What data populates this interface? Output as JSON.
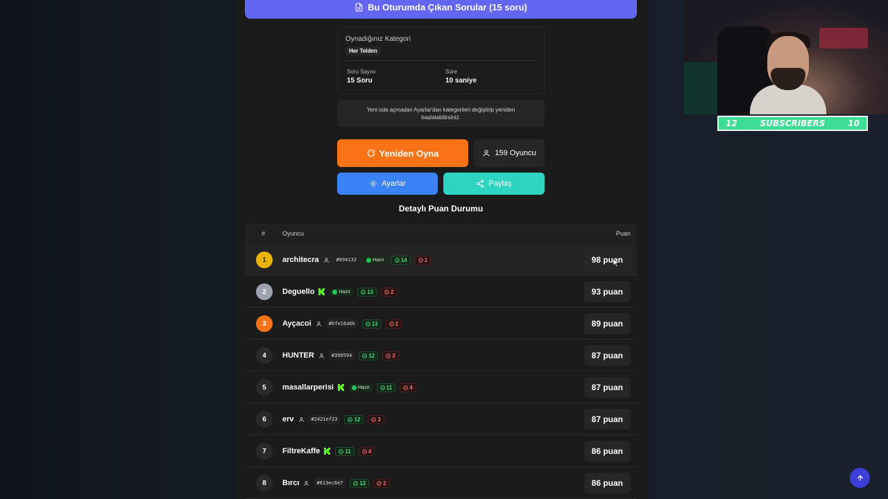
{
  "header": {
    "questions_button": "Bu Oturumda Çıkan Sorular (15 soru)"
  },
  "info": {
    "category_label": "Oynadığınız Kategori",
    "category_value": "Her Telden",
    "question_count_label": "Soru Sayısı",
    "question_count_value": "15 Soru",
    "time_label": "Süre",
    "time_value": "10 saniye"
  },
  "note": "Yeni oda açmadan Ayarlar'dan kategorileri değiştirip yeniden başlatabilirsiniz.",
  "actions": {
    "replay": "Yeniden Oyna",
    "players": "159 Oyuncu",
    "settings": "Ayarlar",
    "share": "Paylaş"
  },
  "scoreboard": {
    "title": "Detaylı Puan Durumu",
    "columns": {
      "rank": "#",
      "player": "Oyuncu",
      "score": "Puan"
    },
    "rows": [
      {
        "rank": "1",
        "name": "architecra",
        "guest": true,
        "kick": false,
        "tag": "#994132",
        "ready": "Hazır",
        "correct": "14",
        "wrong": "1",
        "score": "98 puan"
      },
      {
        "rank": "2",
        "name": "Deguello",
        "guest": false,
        "kick": true,
        "tag": "",
        "ready": "Hazır",
        "correct": "13",
        "wrong": "2",
        "score": "93 puan"
      },
      {
        "rank": "3",
        "name": "Ayçacoi",
        "guest": true,
        "kick": false,
        "tag": "#bfe16a6b",
        "ready": "",
        "correct": "13",
        "wrong": "2",
        "score": "89 puan"
      },
      {
        "rank": "4",
        "name": "HUNTER",
        "guest": true,
        "kick": false,
        "tag": "#390594",
        "ready": "",
        "correct": "12",
        "wrong": "3",
        "score": "87 puan"
      },
      {
        "rank": "5",
        "name": "masallarperisi",
        "guest": false,
        "kick": true,
        "tag": "",
        "ready": "Hazır",
        "correct": "11",
        "wrong": "4",
        "score": "87 puan"
      },
      {
        "rank": "6",
        "name": "erv",
        "guest": true,
        "kick": false,
        "tag": "#2421ef23",
        "ready": "",
        "correct": "12",
        "wrong": "3",
        "score": "87 puan"
      },
      {
        "rank": "7",
        "name": "FiltreKaffe",
        "guest": false,
        "kick": true,
        "tag": "",
        "ready": "",
        "correct": "11",
        "wrong": "4",
        "score": "86 puan"
      },
      {
        "rank": "8",
        "name": "Bırcı",
        "guest": true,
        "kick": false,
        "tag": "#813ec6e7",
        "ready": "",
        "correct": "12",
        "wrong": "2",
        "score": "86 puan"
      }
    ]
  },
  "overlay": {
    "subs_left": "12",
    "subs_label": "SUBSCRIBERS",
    "subs_right": "10"
  },
  "colors": {
    "accent_purple": "#6366f1",
    "orange": "#f97316",
    "blue": "#3b82f6",
    "teal": "#2dd4bf",
    "kick_green": "#53fc18"
  }
}
